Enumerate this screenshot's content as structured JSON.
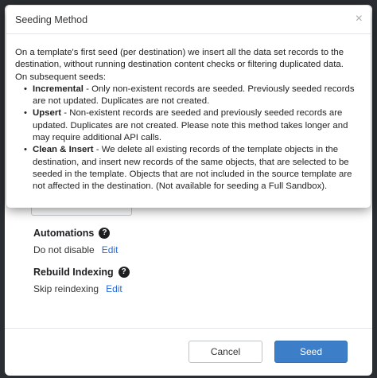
{
  "popup": {
    "title": "Seeding Method",
    "close_glyph": "×",
    "intro": "On a template's first seed (per destination) we insert all the data set records to the destination, without running destination content checks or filtering duplicated data.",
    "subsequent_label": "On subsequent seeds:",
    "items": [
      {
        "term": "Incremental",
        "desc": " - Only non-existent records are seeded. Previously seeded records are not updated. Duplicates are not created."
      },
      {
        "term": "Upsert",
        "desc": " - Non-existent records are seeded and previously seeded records are updated. Duplicates are not created. Please note this method takes longer and may require additional API calls."
      },
      {
        "term": "Clean & Insert",
        "desc": " - We delete all existing records of the template objects in the destination, and insert new records of the same objects, that are selected to be seeded in the template. Objects that are not included in the source template are not affected in the destination. (Not available for seeding a Full Sandbox)."
      }
    ]
  },
  "settings": {
    "automations": {
      "label": "Automations",
      "value": "Do not disable",
      "edit": "Edit",
      "help_icon": "?"
    },
    "rebuild_indexing": {
      "label": "Rebuild Indexing",
      "value": "Skip reindexing",
      "edit": "Edit",
      "help_icon": "?"
    }
  },
  "footer": {
    "cancel_label": "Cancel",
    "seed_label": "Seed"
  },
  "colors": {
    "primary": "#3c7ec7",
    "link": "#2a6ad6"
  }
}
